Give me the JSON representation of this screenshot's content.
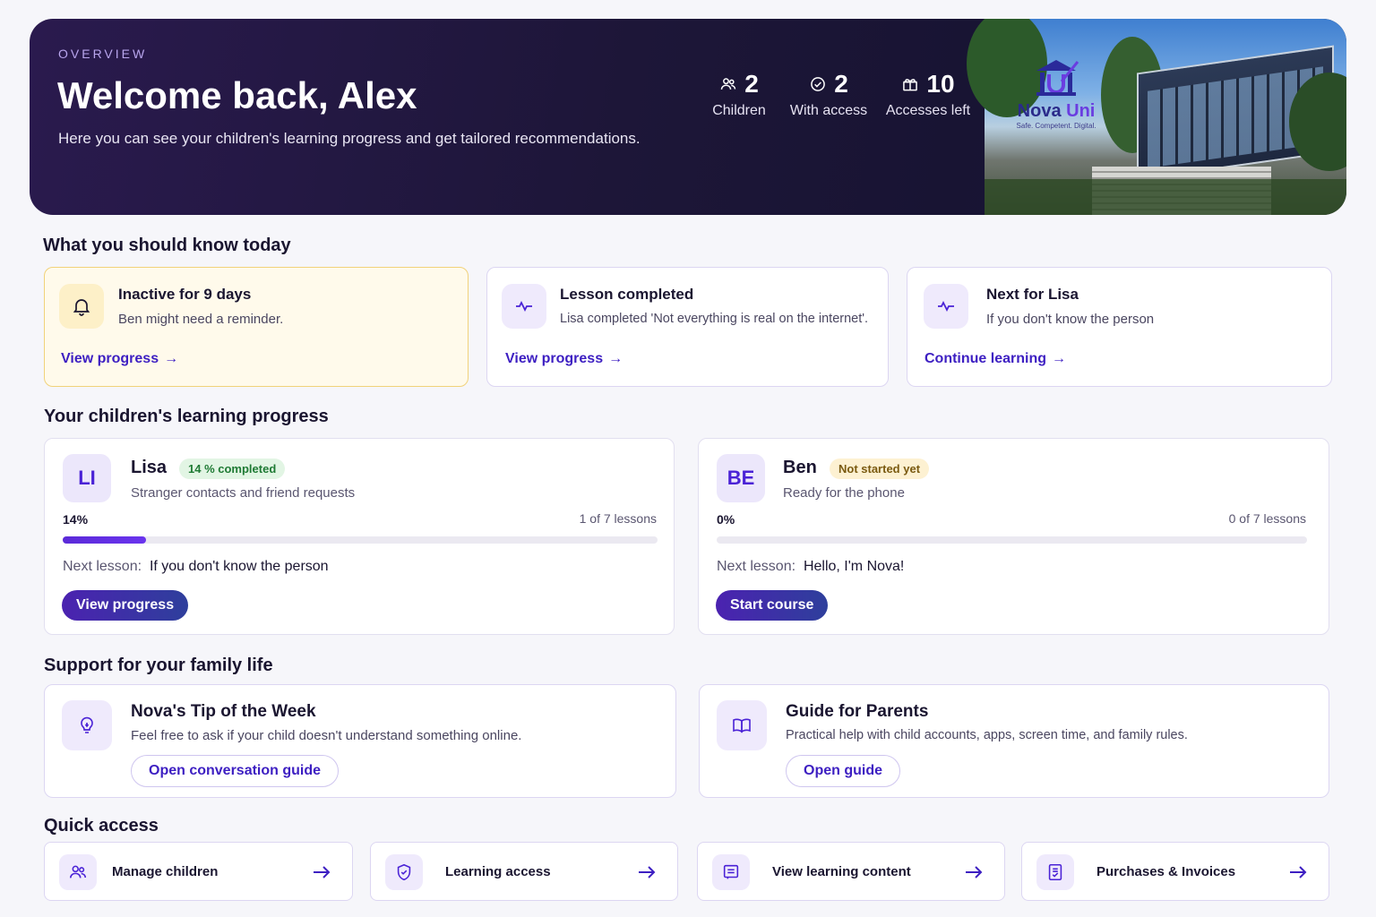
{
  "hero": {
    "eyebrow": "OVERVIEW",
    "title": "Welcome back, Alex",
    "subtitle": "Here you can see your children's learning progress and get tailored recommendations.",
    "stats": [
      {
        "value": "2",
        "label": "Children",
        "icon": "users-icon"
      },
      {
        "value": "2",
        "label": "With access",
        "icon": "check-circle-icon"
      },
      {
        "value": "10",
        "label": "Accesses left",
        "icon": "gift-icon"
      }
    ],
    "image": {
      "logo_name": "Nova",
      "logo_name_accent": "Uni",
      "logo_tagline": "Safe. Competent. Digital."
    }
  },
  "today": {
    "title": "What you should know today",
    "cards": [
      {
        "icon": "bell-icon",
        "title": "Inactive for 9 days",
        "text": "Ben might need a reminder.",
        "link": "View progress"
      },
      {
        "icon": "activity-icon",
        "title": "Lesson completed",
        "text": "Lisa completed 'Not everything is real on the internet'.",
        "link": "View progress"
      },
      {
        "icon": "activity-icon",
        "title": "Next for Lisa",
        "text": "If you don't know the person",
        "link": "Continue learning"
      }
    ]
  },
  "progress": {
    "title": "Your children's learning progress",
    "next_label": "Next lesson:",
    "children": [
      {
        "initials": "LI",
        "name": "Lisa",
        "badge": "14 % completed",
        "course": "Stranger contacts and friend requests",
        "percent_label": "14%",
        "percent": 14,
        "lessons": "1 of 7 lessons",
        "next_lesson": "If you don't know the person",
        "button": "View progress"
      },
      {
        "initials": "BE",
        "name": "Ben",
        "badge": "Not started yet",
        "course": "Ready for the phone",
        "percent_label": "0%",
        "percent": 0,
        "lessons": "0 of 7 lessons",
        "next_lesson": "Hello, I'm Nova!",
        "button": "Start course"
      }
    ]
  },
  "support": {
    "title": "Support for your family life",
    "cards": [
      {
        "icon": "lightbulb-icon",
        "title": "Nova's Tip of the Week",
        "text": "Feel free to ask if your child doesn't understand something online.",
        "button": "Open conversation guide"
      },
      {
        "icon": "book-icon",
        "title": "Guide for Parents",
        "text": "Practical help with child accounts, apps, screen time, and family rules.",
        "button": "Open guide"
      }
    ]
  },
  "quick": {
    "title": "Quick access",
    "items": [
      {
        "icon": "users-icon",
        "label": "Manage children"
      },
      {
        "icon": "shield-check-icon",
        "label": "Learning access"
      },
      {
        "icon": "document-icon",
        "label": "View learning content"
      },
      {
        "icon": "receipt-icon",
        "label": "Purchases & Invoices"
      }
    ]
  },
  "colors": {
    "accent": "#3d1fc2",
    "hero_bg": "#1d1638",
    "warn_bg": "#fffaeb",
    "success": "#1f7a34"
  }
}
